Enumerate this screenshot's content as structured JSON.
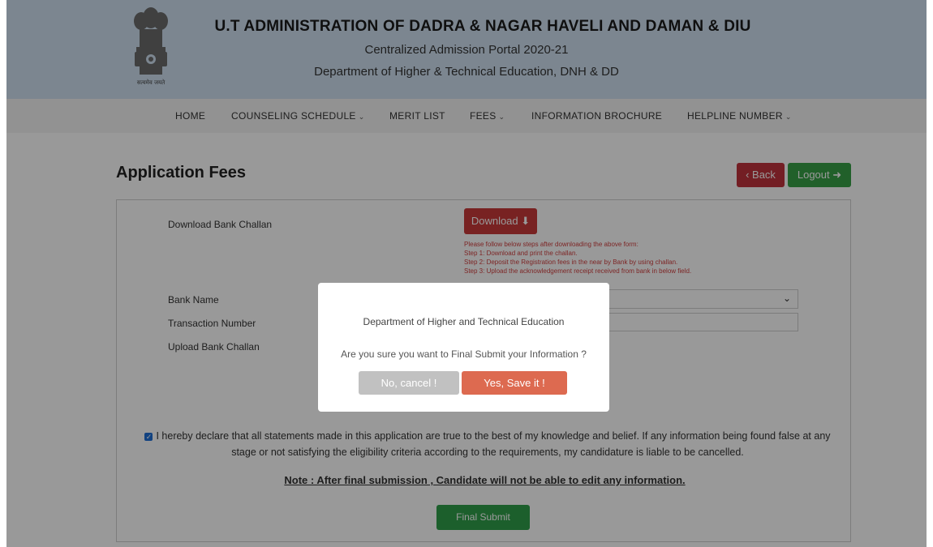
{
  "header": {
    "title": "U.T ADMINISTRATION OF DADRA & NAGAR HAVELI AND DAMAN & DIU",
    "subtitle": "Centralized Admission Portal 2020-21",
    "department": "Department of Higher & Technical Education, DNH & DD",
    "emblem_motto": "सत्यमेव जयते"
  },
  "nav": {
    "items": [
      {
        "label": "HOME",
        "caret": ""
      },
      {
        "label": "COUNSELING SCHEDULE",
        "caret": "⌄"
      },
      {
        "label": "MERIT LIST",
        "caret": ""
      },
      {
        "label": "FEES",
        "caret": "⌄"
      },
      {
        "label": "INFORMATION BROCHURE",
        "caret": ""
      },
      {
        "label": "HELPLINE NUMBER",
        "caret": "⌄"
      }
    ]
  },
  "page": {
    "title": "Application Fees",
    "back_label": "‹ Back",
    "logout_label": "Logout ➜"
  },
  "form": {
    "download_challan_label": "Download Bank Challan",
    "download_button": "Download ⬇",
    "steps": [
      "Please follow below steps after downloading the above form:",
      "Step 1: Download and print the challan.",
      "Step 2: Deposit the Registration fees in the near by Bank by using challan.",
      "Step 3: Upload the acknowledgement receipt received from bank in below field."
    ],
    "bank_name_label": "Bank Name",
    "transaction_number_label": "Transaction Number",
    "upload_challan_label": "Upload Bank Challan",
    "declaration": "I hereby declare that all statements made in this application are true to the best of my knowledge and belief. If any information being found false at any stage or not satisfying the eligibility criteria according to the requirements, my candidature is liable to be cancelled.",
    "note": "Note : After final submission , Candidate will not be able to edit any information.",
    "final_submit": "Final Submit"
  },
  "modal": {
    "title": "Department of Higher and Technical Education",
    "message": "Are you sure you want to Final Submit your Information ?",
    "cancel_label": "No, cancel !",
    "confirm_label": "Yes, Save it !"
  },
  "colors": {
    "header_bg": "#cfe0f1",
    "danger": "#c93a3a",
    "success": "#2f9e4a",
    "confirm": "#dd6a50"
  }
}
